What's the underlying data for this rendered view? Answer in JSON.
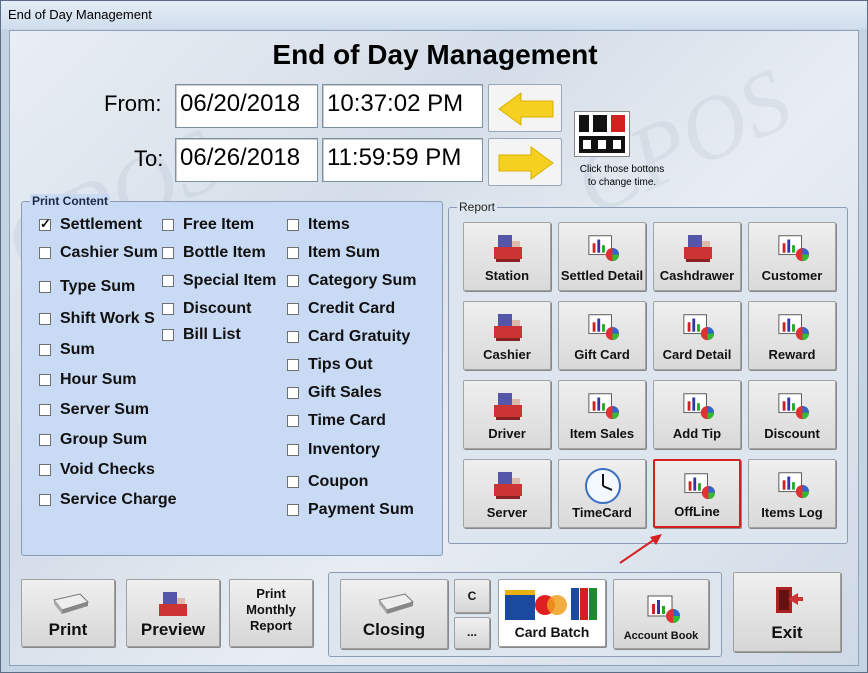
{
  "window": {
    "title": "End of Day Management"
  },
  "page_title": "End of Day Management",
  "range": {
    "from_label": "From:",
    "from_date": "06/20/2018",
    "from_time": "10:37:02 PM",
    "to_label": "To:",
    "to_date": "06/26/2018",
    "to_time": "11:59:59 PM",
    "clock_hint_line1": "Click those bottons",
    "clock_hint_line2": "to change time."
  },
  "print_content": {
    "title": "Print Content",
    "col1": [
      {
        "label": "Settlement",
        "checked": true
      },
      {
        "label": "Cashier Sum",
        "checked": false
      },
      {
        "label": "Type Sum",
        "checked": false
      },
      {
        "label": "Shift Work S",
        "checked": false
      },
      {
        "label": "Sum",
        "checked": false
      },
      {
        "label": "Hour Sum",
        "checked": false
      },
      {
        "label": "Server Sum",
        "checked": false
      },
      {
        "label": "Group Sum",
        "checked": false
      },
      {
        "label": "Void Checks",
        "checked": false
      },
      {
        "label": "Service Charge",
        "checked": false
      }
    ],
    "col2": [
      {
        "label": "Free Item",
        "checked": false
      },
      {
        "label": "Bottle Item",
        "checked": false
      },
      {
        "label": "Special Item",
        "checked": false
      },
      {
        "label": "Discount",
        "checked": false
      },
      {
        "label": "Bill List",
        "checked": false
      }
    ],
    "col3": [
      {
        "label": "Items",
        "checked": false
      },
      {
        "label": "Item Sum",
        "checked": false
      },
      {
        "label": "Category Sum",
        "checked": false
      },
      {
        "label": "Credit Card",
        "checked": false
      },
      {
        "label": "Card Gratuity",
        "checked": false
      },
      {
        "label": "Tips Out",
        "checked": false
      },
      {
        "label": "Gift Sales",
        "checked": false
      },
      {
        "label": "Time Card",
        "checked": false
      },
      {
        "label": "Inventory",
        "checked": false
      },
      {
        "label": "Coupon",
        "checked": false
      },
      {
        "label": "Payment Sum",
        "checked": false
      }
    ]
  },
  "report": {
    "title": "Report",
    "buttons": [
      {
        "label": "Station",
        "icon": "register-icon"
      },
      {
        "label": "Settled Detail",
        "icon": "chart-icon"
      },
      {
        "label": "Cashdrawer",
        "icon": "register-icon"
      },
      {
        "label": "Customer",
        "icon": "chart-icon"
      },
      {
        "label": "Cashier",
        "icon": "register-icon"
      },
      {
        "label": "Gift Card",
        "icon": "chart-icon"
      },
      {
        "label": "Card Detail",
        "icon": "chart-icon"
      },
      {
        "label": "Reward",
        "icon": "chart-icon"
      },
      {
        "label": "Driver",
        "icon": "register-icon"
      },
      {
        "label": "Item Sales",
        "icon": "chart-icon"
      },
      {
        "label": "Add Tip",
        "icon": "chart-icon"
      },
      {
        "label": "Discount",
        "icon": "chart-icon"
      },
      {
        "label": "Server",
        "icon": "register-icon"
      },
      {
        "label": "TimeCard",
        "icon": "clock-icon"
      },
      {
        "label": "OffLine",
        "icon": "chart-icon",
        "selected": true
      },
      {
        "label": "Items Log",
        "icon": "chart-icon"
      }
    ]
  },
  "bottom": {
    "print": "Print",
    "preview": "Preview",
    "print_monthly_line1": "Print",
    "print_monthly_line2": "Monthly",
    "print_monthly_line3": "Report",
    "closing": "Closing",
    "c_button": "C",
    "more_button": "...",
    "card_batch": "Card Batch",
    "account_book": "Account Book",
    "exit": "Exit"
  },
  "colors": {
    "highlight": "#d52020",
    "arrow": "#f5d020"
  }
}
